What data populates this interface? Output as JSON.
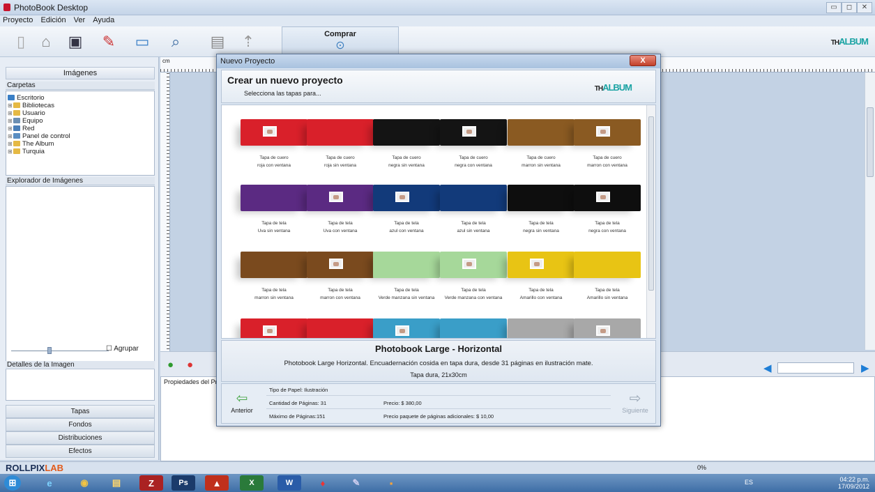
{
  "window": {
    "title": "PhotoBook Desktop"
  },
  "menu": [
    "Proyecto",
    "Edición",
    "Ver",
    "Ayuda"
  ],
  "toolbar": {
    "comprar_label": "Comprar"
  },
  "brand": {
    "prefix": "TH",
    "name": "ALBUM"
  },
  "left_panel": {
    "images_header": "Imágenes",
    "carpetas_label": "Carpetas",
    "tree": [
      "Escritorio",
      "Bibliotecas",
      "Usuario",
      "Equipo",
      "Red",
      "Panel de control",
      "The Album",
      "Turquia"
    ],
    "explorer_label": "Explorador de Imágenes",
    "agrupar_label": "Agrupar",
    "details_label": "Detalles de la Imagen",
    "nav_buttons": [
      "Tapas",
      "Fondos",
      "Distribuciones",
      "Efectos"
    ]
  },
  "ruler_label": "cm",
  "properties_label": "Propiedades del Proy",
  "status": {
    "brand": "ROLLPIX",
    "brand_suffix": "LAB",
    "percent": "0%"
  },
  "taskbar": {
    "time": "04:22 p.m.",
    "date": "17/09/2012",
    "lang": "ES"
  },
  "dialog": {
    "title": "Nuevo Proyecto",
    "close_label": "X",
    "heading": "Crear un nuevo proyecto",
    "subheading": "Selecciona las tapas para...",
    "covers": [
      {
        "line1": "Tapa de cuero",
        "line2": "roja con ventana",
        "color": "#d9202a",
        "window": true
      },
      {
        "line1": "Tapa de cuero",
        "line2": "roja sin ventana",
        "color": "#d9202a",
        "window": false
      },
      {
        "line1": "Tapa de cuero",
        "line2": "negra sin ventana",
        "color": "#141414",
        "window": false
      },
      {
        "line1": "Tapa de cuero",
        "line2": "negra con ventana",
        "color": "#141414",
        "window": true
      },
      {
        "line1": "Tapa de cuero",
        "line2": "marron sin ventana",
        "color": "#8a5a22",
        "window": false
      },
      {
        "line1": "Tapa de cuero",
        "line2": "marron con ventana",
        "color": "#8a5a22",
        "window": true
      },
      {
        "line1": "Tapa de tela",
        "line2": "Uva sin ventana",
        "color": "#5b2a82",
        "window": false
      },
      {
        "line1": "Tapa de tela",
        "line2": "Uva con ventana",
        "color": "#5b2a82",
        "window": true
      },
      {
        "line1": "Tapa de tela",
        "line2": "azul con ventana",
        "color": "#123a7a",
        "window": true
      },
      {
        "line1": "Tapa de tela",
        "line2": "azul sin ventana",
        "color": "#123a7a",
        "window": false
      },
      {
        "line1": "Tapa de tela",
        "line2": "negra sin ventana",
        "color": "#0e0e0e",
        "window": false
      },
      {
        "line1": "Tapa de tela",
        "line2": "negra con ventana",
        "color": "#0e0e0e",
        "window": true
      },
      {
        "line1": "Tapa de tela",
        "line2": "marron sin ventana",
        "color": "#7a4a1e",
        "window": false
      },
      {
        "line1": "Tapa de tela",
        "line2": "marron con ventana",
        "color": "#7a4a1e",
        "window": true
      },
      {
        "line1": "Tapa de tela",
        "line2": "Verde manzana sin ventana",
        "color": "#a6d89a",
        "window": false
      },
      {
        "line1": "Tapa de tela",
        "line2": "Verde manzana con ventana",
        "color": "#a6d89a",
        "window": true
      },
      {
        "line1": "Tapa de tela",
        "line2": "Amarillo con ventana",
        "color": "#e8c414",
        "window": true
      },
      {
        "line1": "Tapa de tela",
        "line2": "Amarillo sin ventana",
        "color": "#e8c414",
        "window": false
      },
      {
        "line1": "",
        "line2": "",
        "color": "#d9202a",
        "window": true
      },
      {
        "line1": "",
        "line2": "",
        "color": "#d9202a",
        "window": false
      },
      {
        "line1": "",
        "line2": "",
        "color": "#3a9ec8",
        "window": true
      },
      {
        "line1": "",
        "line2": "",
        "color": "#3a9ec8",
        "window": false
      },
      {
        "line1": "",
        "line2": "",
        "color": "#a8a8a8",
        "window": false
      },
      {
        "line1": "",
        "line2": "",
        "color": "#a8a8a8",
        "window": true
      }
    ],
    "product_name": "Photobook Large - Horizontal",
    "product_desc": "Photobook Large Horizontal. Encuadernación cosida en tapa dura, desde 31 páginas en ilustración mate.",
    "product_size": "Tapa dura, 21x30cm",
    "paper_type": "Tipo de Papel: Ilustración",
    "page_count": "Cantidad de Páginas: 31",
    "max_pages": "Máximo de Páginas:151",
    "price": "Precio: $ 380,00",
    "extra_price": "Precio paquete de páginas adicionales: $ 10,00",
    "prev_label": "Anterior",
    "next_label": "Siguiente"
  }
}
